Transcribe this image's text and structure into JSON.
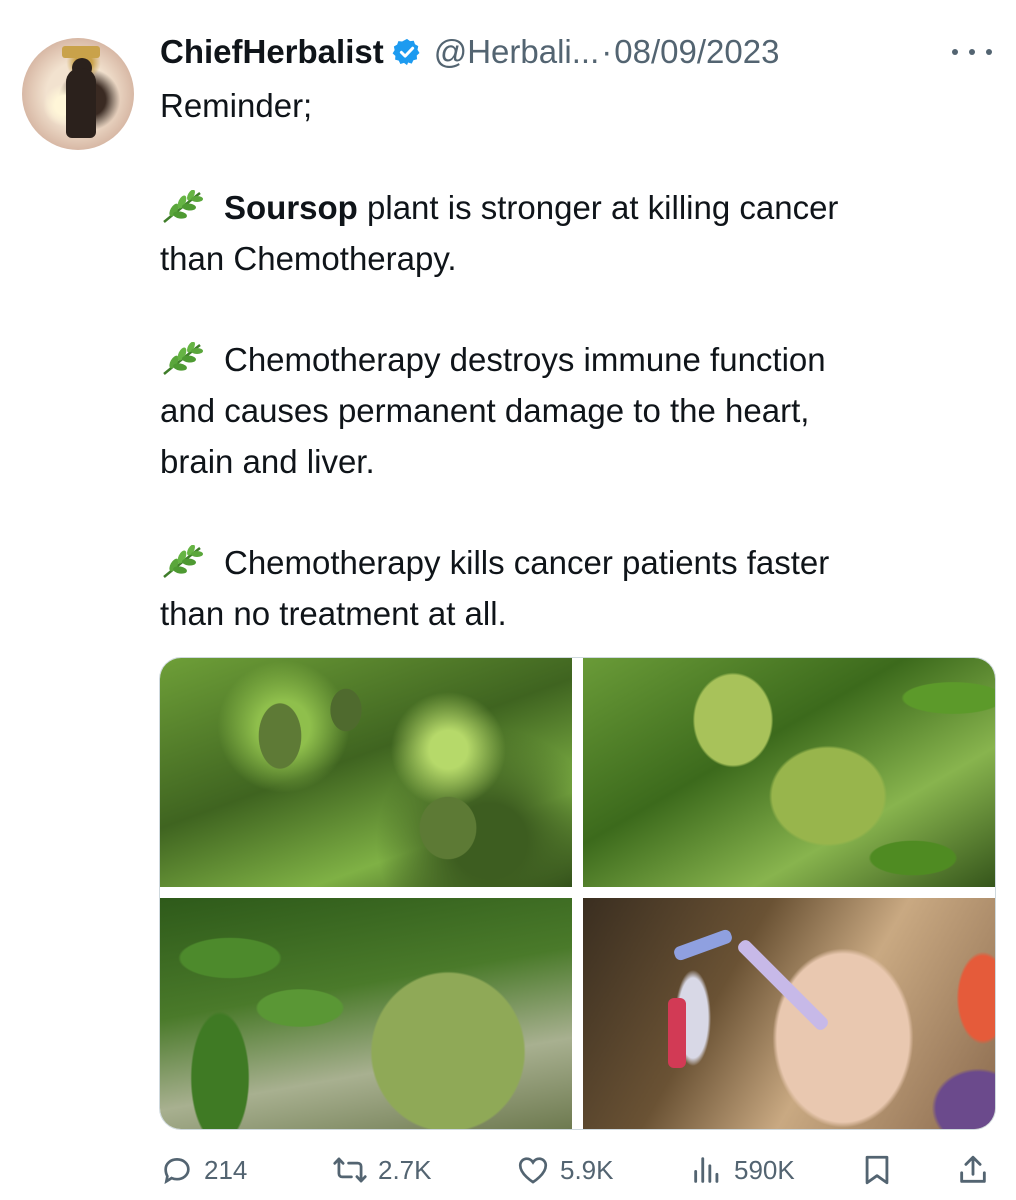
{
  "tweet": {
    "author_name": "ChiefHerbalist",
    "handle": "@Herbali...",
    "separator": "·",
    "date": "08/09/2023",
    "verified": true,
    "lines": {
      "intro": "Reminder;",
      "p1_bold": "Soursop",
      "p1_rest_a": " plant is stronger at killing cancer",
      "p1_rest_b": "than Chemotherapy.",
      "p2_a": "Chemotherapy destroys immune function",
      "p2_b": "and causes permanent damage to the heart,",
      "p2_c": "brain and liver.",
      "p3_a": "Chemotherapy kills cancer patients faster",
      "p3_b": "than no treatment at all."
    },
    "emoji_icon": "herb-icon",
    "media_count": 4
  },
  "actions": {
    "replies": "214",
    "reposts": "2.7K",
    "likes": "5.9K",
    "views": "590K"
  },
  "colors": {
    "text": "#0f1419",
    "secondary": "#536471",
    "verified": "#1d9bf0",
    "border": "#cfd9de"
  }
}
